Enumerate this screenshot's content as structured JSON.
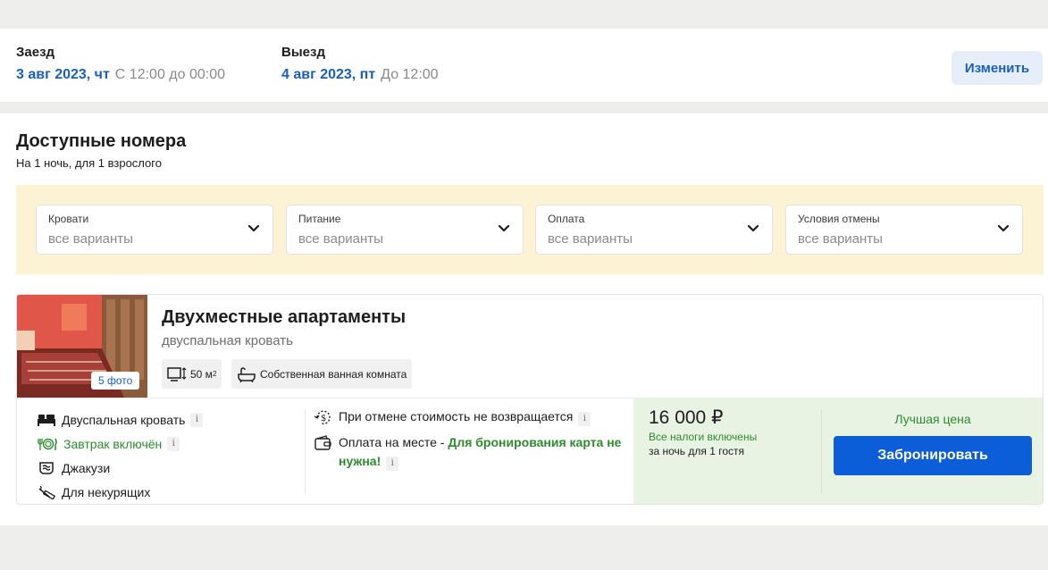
{
  "checkin": {
    "label": "Заезд",
    "date": "3 авг 2023, чт",
    "time": "С 12:00 до 00:00"
  },
  "checkout": {
    "label": "Выезд",
    "date": "4 авг 2023, пт",
    "time": "До 12:00"
  },
  "change_button": "Изменить",
  "section": {
    "title": "Доступные номера",
    "subtitle": "На 1 ночь, для 1 взрослого"
  },
  "filters": [
    {
      "label": "Кровати",
      "value": "все варианты"
    },
    {
      "label": "Питание",
      "value": "все варианты"
    },
    {
      "label": "Оплата",
      "value": "все варианты"
    },
    {
      "label": "Условия отмены",
      "value": "все варианты"
    }
  ],
  "room": {
    "title": "Двухместные апартаменты",
    "bed": "двуспальная кровать",
    "photo_count": "5 фото",
    "area_value": "50 м",
    "area_sup": "2",
    "bathroom": "Собственная ванная комната",
    "amenities": [
      {
        "label": "Двуспальная кровать",
        "icon": "bed-icon"
      },
      {
        "label": "Завтрак включён",
        "icon": "breakfast-icon"
      },
      {
        "label": "Джакузи",
        "icon": "jacuzzi-icon"
      },
      {
        "label": "Для некурящих",
        "icon": "no-smoking-icon"
      }
    ],
    "policies": {
      "cancel": "При отмене стоимость не возвращается",
      "payment_prefix": "Оплата на месте - ",
      "payment_highlight": "Для бронирования карта не нужна!"
    },
    "info_glyph": "i",
    "price": "16 000 ₽",
    "taxes": "Все налоги включены",
    "per_night": "за ночь для 1 гостя",
    "best_price": "Лучшая цена",
    "book_button": "Забронировать"
  },
  "colors": {
    "accent": "#1a5fbe",
    "green": "#2e8b2e",
    "book": "#0b5ed7",
    "filters_bg": "#fcf3d4",
    "price_bg": "#e8f3e4"
  }
}
